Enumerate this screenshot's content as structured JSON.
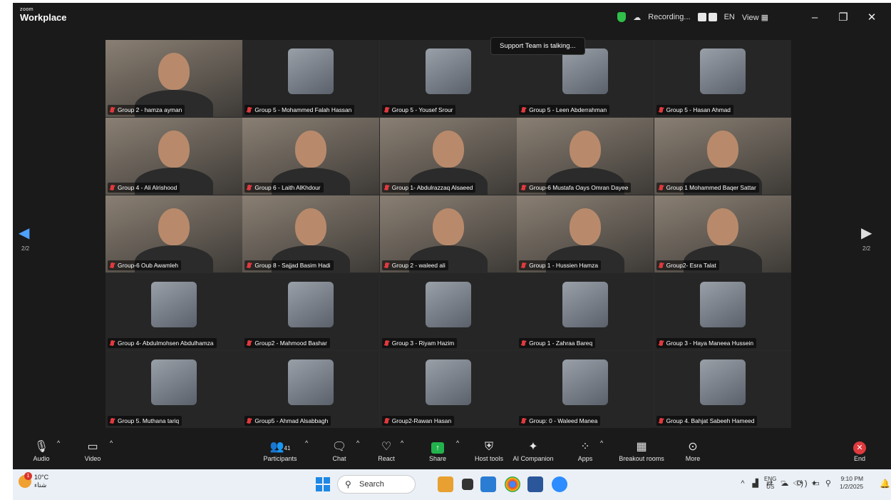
{
  "app": {
    "brand_small": "zoom",
    "brand_big": "Workplace"
  },
  "titlebar": {
    "recording_label": "Recording...",
    "lang": "EN",
    "view_label": "View",
    "minimize": "–",
    "restore": "❐",
    "close": "✕"
  },
  "speaker_banner": "Support Team is talking...",
  "page_indicator": "2/2",
  "tiles": [
    {
      "name": "Group 2 - hamza ayman",
      "video": true
    },
    {
      "name": "Group 5 - Mohammed Falah Hassan",
      "video": false
    },
    {
      "name": "Group 5 - Yousef Srour",
      "video": false
    },
    {
      "name": "Group 5 - Leen Abderrahman",
      "video": false
    },
    {
      "name": "Group 5 - Hasan Ahmad",
      "video": false
    },
    {
      "name": "Group 4 - Ali Alrishood",
      "video": true
    },
    {
      "name": "Group 6 - Laith AlKhdour",
      "video": true
    },
    {
      "name": "Group 1- Abdulrazzaq Alsaeed",
      "video": true
    },
    {
      "name": "Group-6 Mustafa Oays Omran Dayee",
      "video": true
    },
    {
      "name": "Group 1 Mohammed Baqer Sattar",
      "video": true
    },
    {
      "name": "Group-6 Oub Awamleh",
      "video": true
    },
    {
      "name": "Group 8 - Sajjad Basim Hadi",
      "video": true
    },
    {
      "name": "Group 2 - waleed ali",
      "video": true
    },
    {
      "name": "Group 1 - Hussien Hamza",
      "video": true
    },
    {
      "name": "Group2- Esra Talat",
      "video": true
    },
    {
      "name": "Group 4- Abdulmohsen Abdulhamza",
      "video": false
    },
    {
      "name": "Group2 - Mahmood Bashar",
      "video": false
    },
    {
      "name": "Group 3 - Riyam Hazim",
      "video": false
    },
    {
      "name": "Group 1 - Zahraa Bareq",
      "video": false
    },
    {
      "name": "Group 3 - Haya Maneea Hussein",
      "video": false
    },
    {
      "name": "Group 5. Muthana tariq",
      "video": false
    },
    {
      "name": "Group5 - Ahmad Alsabbagh",
      "video": false
    },
    {
      "name": "Group2-Rawan Hasan",
      "video": false
    },
    {
      "name": "Group: 0 - Waleed Manea",
      "video": false
    },
    {
      "name": "Group 4. Bahjat Sabeeh Hameed",
      "video": false
    }
  ],
  "toolbar": {
    "audio": "Audio",
    "video": "Video",
    "participants": "Participants",
    "participants_count": "41",
    "chat": "Chat",
    "react": "React",
    "share": "Share",
    "host_tools": "Host tools",
    "ai_companion": "AI Companion",
    "apps": "Apps",
    "breakout_rooms": "Breakout rooms",
    "more": "More",
    "end": "End"
  },
  "taskbar": {
    "temp": "10°C",
    "weather_text": "شتاء",
    "notification_count": "1",
    "search_placeholder": "Search",
    "lang_top": "ENG",
    "lang_bottom": "US",
    "time": "9:10 PM",
    "date": "1/2/2025"
  }
}
